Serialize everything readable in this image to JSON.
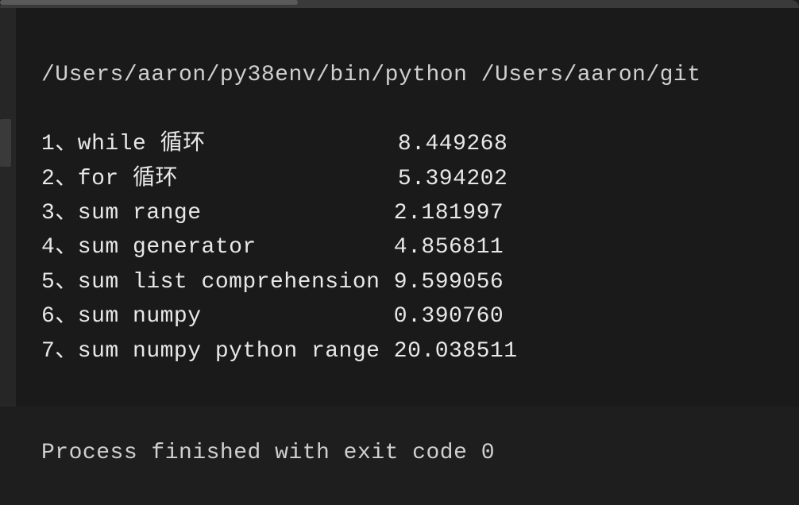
{
  "command_line": "/Users/aaron/py38env/bin/python /Users/aaron/git",
  "rows": [
    {
      "label": "1、while 循环              ",
      "value": "8.449268"
    },
    {
      "label": "2、for 循环                ",
      "value": "5.394202"
    },
    {
      "label": "3、sum range              ",
      "value": "2.181997"
    },
    {
      "label": "4、sum generator          ",
      "value": "4.856811"
    },
    {
      "label": "5、sum list comprehension ",
      "value": "9.599056"
    },
    {
      "label": "6、sum numpy              ",
      "value": "0.390760"
    },
    {
      "label": "7、sum numpy python range ",
      "value": "20.038511"
    }
  ],
  "exit_message": "Process finished with exit code 0"
}
